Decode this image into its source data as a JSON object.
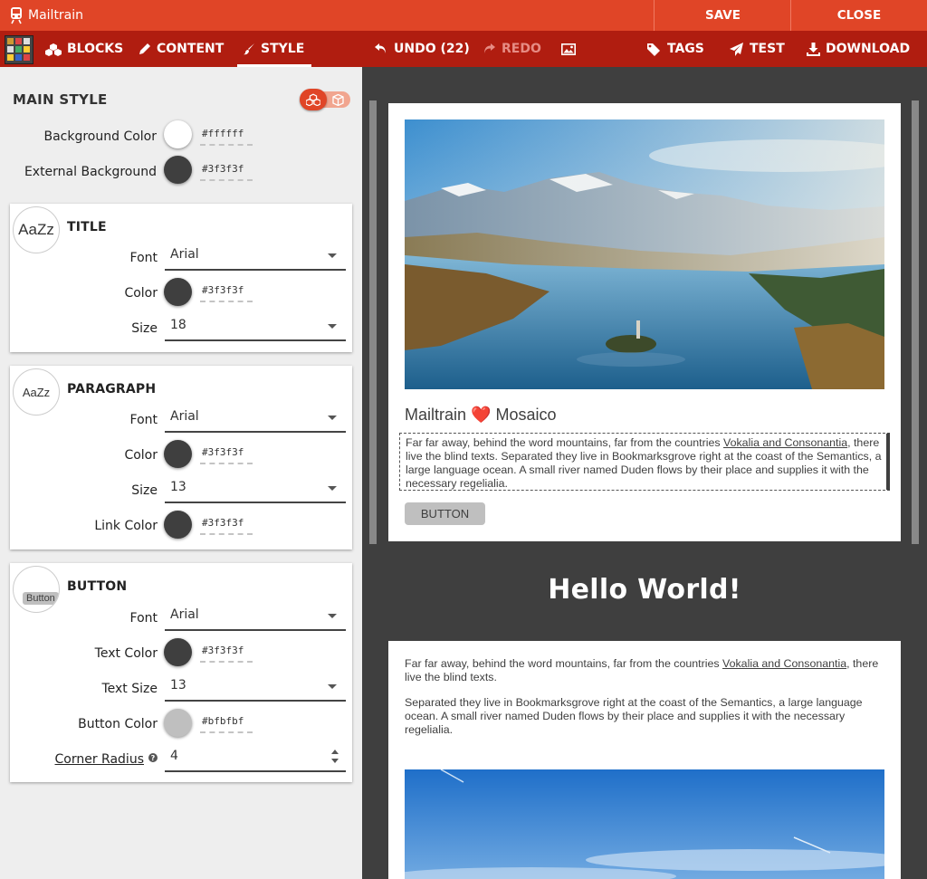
{
  "app": {
    "title": "Mailtrain"
  },
  "top_actions": {
    "save": "SAVE",
    "close": "CLOSE"
  },
  "toolbar": {
    "blocks": "BLOCKS",
    "content": "CONTENT",
    "style": "STYLE",
    "undo": "UNDO (22)",
    "redo": "REDO",
    "tags": "TAGS",
    "test": "TEST",
    "download": "DOWNLOAD"
  },
  "main_style": {
    "heading": "MAIN STYLE",
    "background_color": {
      "label": "Background Color",
      "value": "#ffffff"
    },
    "external_background": {
      "label": "External Background",
      "value": "#3f3f3f"
    }
  },
  "title_section": {
    "heading": "TITLE",
    "preview": "AaZz",
    "font": {
      "label": "Font",
      "value": "Arial"
    },
    "color": {
      "label": "Color",
      "value": "#3f3f3f"
    },
    "size": {
      "label": "Size",
      "value": "18"
    }
  },
  "paragraph_section": {
    "heading": "PARAGRAPH",
    "preview": "AaZz",
    "font": {
      "label": "Font",
      "value": "Arial"
    },
    "color": {
      "label": "Color",
      "value": "#3f3f3f"
    },
    "size": {
      "label": "Size",
      "value": "13"
    },
    "link_color": {
      "label": "Link Color",
      "value": "#3f3f3f"
    }
  },
  "button_section": {
    "heading": "BUTTON",
    "preview": "Button",
    "font": {
      "label": "Font",
      "value": "Arial"
    },
    "text_color": {
      "label": "Text Color",
      "value": "#3f3f3f"
    },
    "text_size": {
      "label": "Text Size",
      "value": "13"
    },
    "button_color": {
      "label": "Button Color",
      "value": "#bfbfbf"
    },
    "corner_radius": {
      "label": "Corner Radius",
      "value": "4"
    }
  },
  "email": {
    "title_left": "Mailtrain",
    "title_heart": "❤️",
    "title_right": "Mosaico",
    "para_before_link": "Far far away, behind the word mountains, far from the countries ",
    "para_link": "Vokalia and Consonantia",
    "para_after_link": ", there live the blind texts. Separated they live in Bookmarksgrove right at the coast of the Semantics, a large language ocean. A small river named Duden flows by their place and supplies it with the necessary regelialia.",
    "button_label": "BUTTON",
    "hello": "Hello World!",
    "p1_before_link": "Far far away, behind the word mountains, far from the countries ",
    "p1_link": "Vokalia and Consonantia",
    "p1_after_link": ", there live the blind texts.",
    "p2": "Separated they live in Bookmarksgrove right at the coast of the Semantics, a large language ocean. A small river named Duden flows by their place and supplies it with the necessary regelialia."
  },
  "colors": {
    "brand": "#e04527",
    "toolbar": "#b01d10",
    "canvas": "#3f3f3f",
    "panel": "#eeeeee"
  },
  "icons": [
    "train-icon",
    "cubes-icon",
    "pencil-icon",
    "brush-icon",
    "undo-icon",
    "redo-icon",
    "image-icon",
    "tag-icon",
    "paper-plane-icon",
    "download-icon",
    "cube-icon",
    "help-icon"
  ]
}
